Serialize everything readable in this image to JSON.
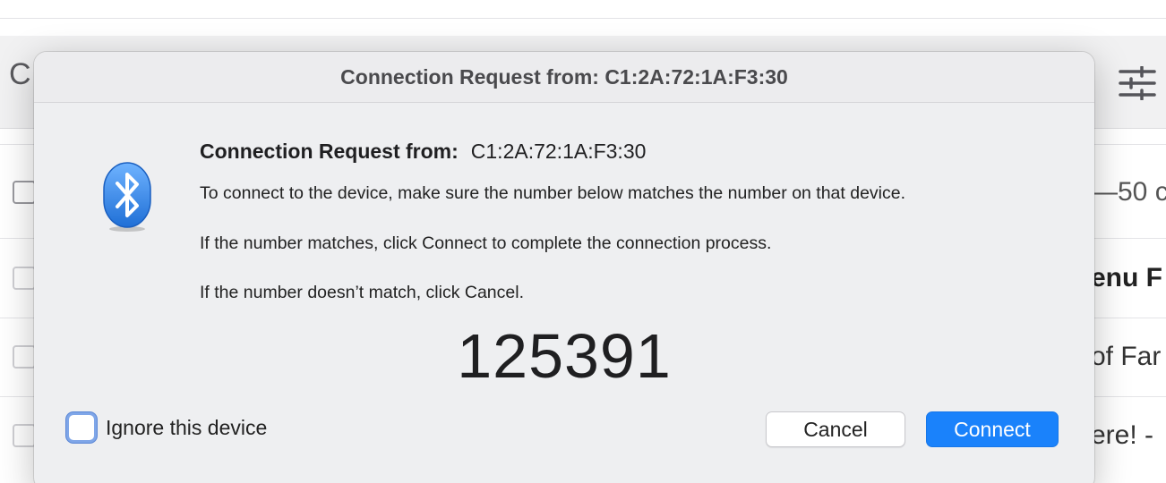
{
  "background": {
    "search_glyph": "C",
    "right_texts": [
      "—50 c",
      "enu F",
      "of Far",
      "ere! -"
    ]
  },
  "dialog": {
    "title": "Connection Request from: C1:2A:72:1A:F3:30",
    "heading_label": "Connection Request from:",
    "device_address": "C1:2A:72:1A:F3:30",
    "instruction": "To connect to the device, make sure the number below matches the number on that device.",
    "match_text": "If the number matches, click Connect to complete the connection process.",
    "mismatch_text": "If the number doesn’t match, click Cancel.",
    "passkey": "125391",
    "ignore_label": "Ignore this device",
    "ignore_checked": false,
    "cancel_label": "Cancel",
    "connect_label": "Connect",
    "icon": "bluetooth-icon",
    "colors": {
      "accent": "#1a82fb",
      "bluetooth_blue": "#2f86e8"
    }
  }
}
